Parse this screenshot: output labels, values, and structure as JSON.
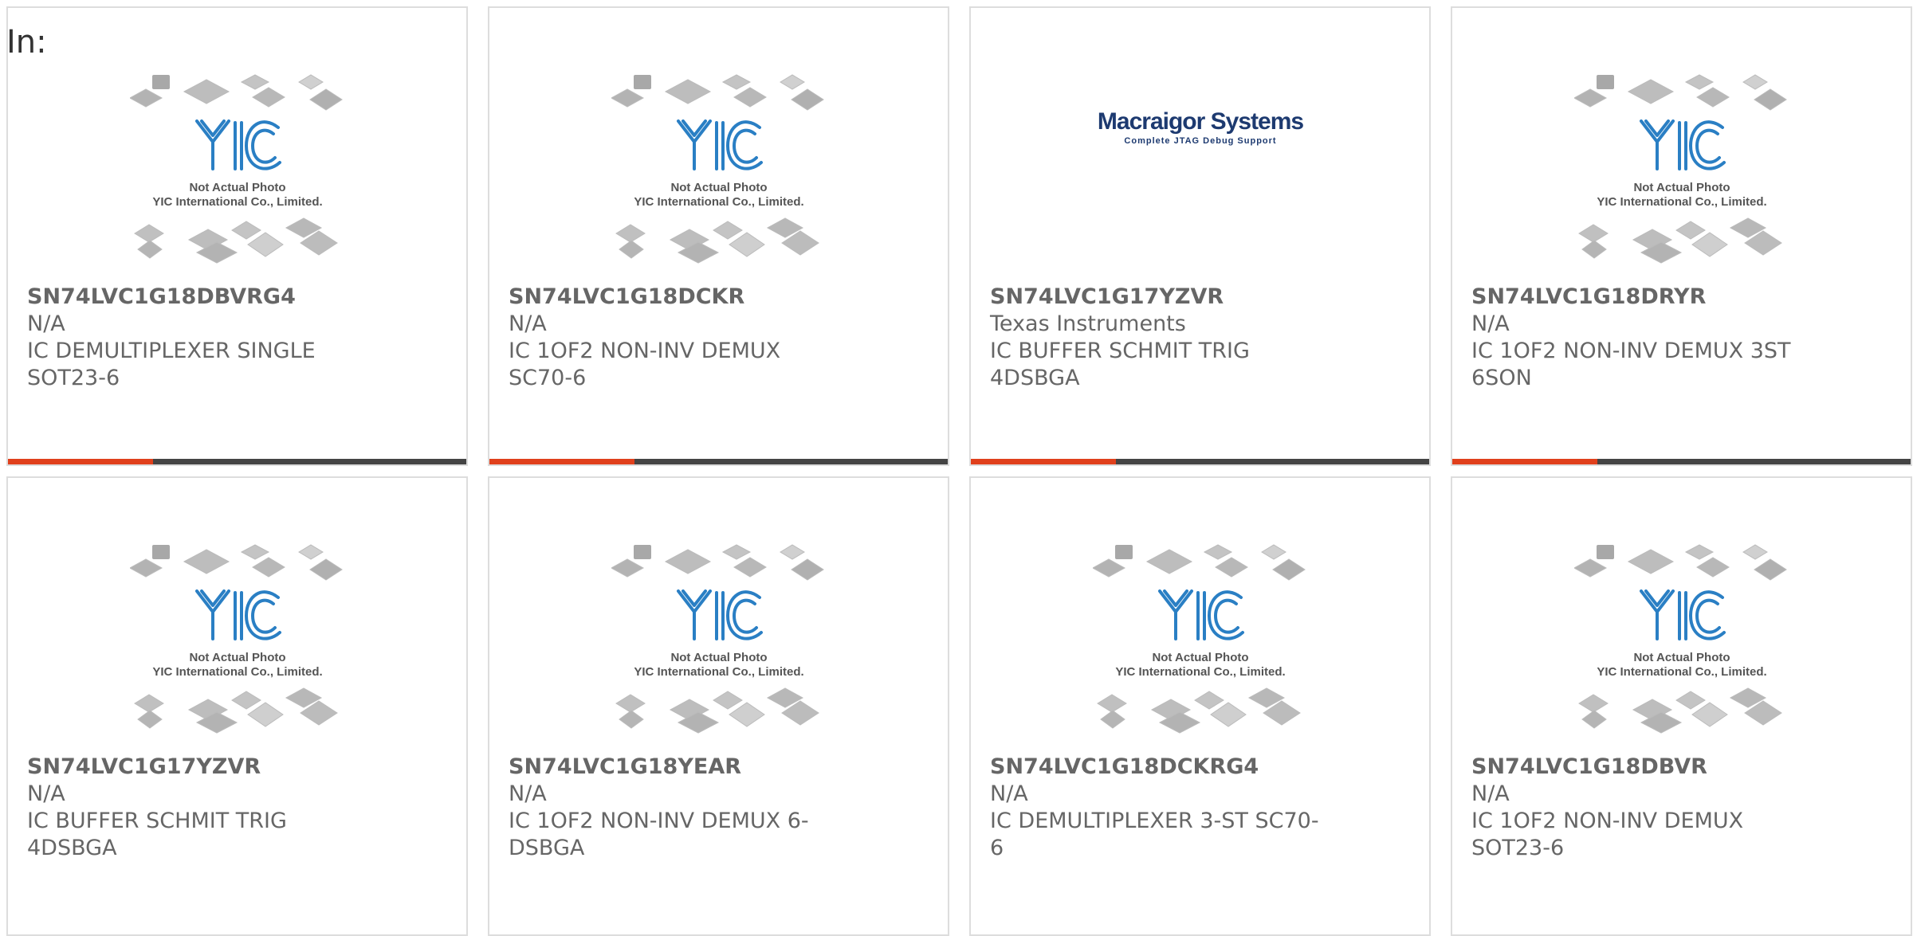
{
  "in_label": "In:",
  "placeholder_lines": [
    "Not Actual Photo",
    "YIC International Co., Limited."
  ],
  "macraigor_lines": [
    "Macraigor Systems",
    "Complete JTAG Debug Support"
  ],
  "colors": {
    "accent": "#e0401c",
    "bar": "#444444",
    "border": "#dddddd",
    "text": "#666666",
    "yic_blue": "#2a7fc4",
    "macraigor_navy": "#1d3a70"
  },
  "products": [
    {
      "part": "SN74LVC1G18DBVRG4",
      "manufacturer": "N/A",
      "description": "IC DEMULTIPLEXER SINGLE SOT23-6",
      "image": "yic-placeholder"
    },
    {
      "part": "SN74LVC1G18DCKR",
      "manufacturer": "N/A",
      "description": "IC 1OF2 NON-INV DEMUX SC70-6",
      "image": "yic-placeholder"
    },
    {
      "part": "SN74LVC1G17YZVR",
      "manufacturer": "Texas Instruments",
      "description": "IC BUFFER SCHMIT TRIG 4DSBGA",
      "image": "macraigor-logo"
    },
    {
      "part": "SN74LVC1G18DRYR",
      "manufacturer": "N/A",
      "description": "IC 1OF2 NON-INV DEMUX 3ST 6SON",
      "image": "yic-placeholder"
    },
    {
      "part": "SN74LVC1G17YZVR",
      "manufacturer": "N/A",
      "description": "IC BUFFER SCHMIT TRIG 4DSBGA",
      "image": "yic-placeholder"
    },
    {
      "part": "SN74LVC1G18YEAR",
      "manufacturer": "N/A",
      "description": "IC 1OF2 NON-INV DEMUX 6-DSBGA",
      "image": "yic-placeholder"
    },
    {
      "part": "SN74LVC1G18DCKRG4",
      "manufacturer": "N/A",
      "description": "IC DEMULTIPLEXER 3-ST SC70-6",
      "image": "yic-placeholder"
    },
    {
      "part": "SN74LVC1G18DBVR",
      "manufacturer": "N/A",
      "description": "IC 1OF2 NON-INV DEMUX SOT23-6",
      "image": "yic-placeholder"
    }
  ]
}
